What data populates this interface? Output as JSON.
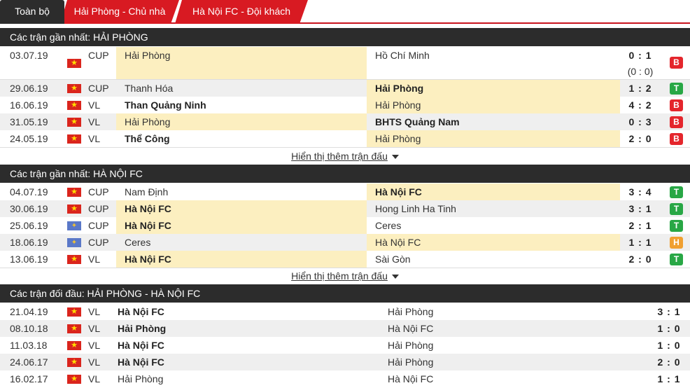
{
  "tabs": [
    "Toàn bộ",
    "Hải Phòng - Chủ nhà",
    "Hà Nội FC - Đội khách"
  ],
  "sections": [
    {
      "title": "Các trận gần nhất: HẢI PHÒNG",
      "more": "Hiển thị thêm trận đấu",
      "matches": [
        {
          "date": "03.07.19",
          "flag": "vn",
          "league": "CUP",
          "home": "Hải Phòng",
          "away": "Hồ Chí Minh",
          "score": "0 : 1",
          "score_sub": "(0 : 0)",
          "result": "B"
        },
        {
          "date": "29.06.19",
          "flag": "vn",
          "league": "CUP",
          "home": "Thanh Hóa",
          "away": "Hải Phòng",
          "score": "1 : 2",
          "result": "T"
        },
        {
          "date": "16.06.19",
          "flag": "vn",
          "league": "VL",
          "home": "Than Quảng Ninh",
          "away": "Hải Phòng",
          "score": "4 : 2",
          "result": "B"
        },
        {
          "date": "31.05.19",
          "flag": "vn",
          "league": "VL",
          "home": "Hải Phòng",
          "away": "BHTS Quảng Nam",
          "score": "0 : 3",
          "result": "B"
        },
        {
          "date": "24.05.19",
          "flag": "vn",
          "league": "VL",
          "home": "Thể Công",
          "away": "Hải Phòng",
          "score": "2 : 0",
          "result": "B"
        }
      ]
    },
    {
      "title": "Các trận gần nhất: HÀ NỘI FC",
      "more": "Hiển thị thêm trận đấu",
      "matches": [
        {
          "date": "04.07.19",
          "flag": "vn",
          "league": "CUP",
          "home": "Nam Định",
          "away": "Hà Nội FC",
          "score": "3 : 4",
          "result": "T"
        },
        {
          "date": "30.06.19",
          "flag": "vn",
          "league": "CUP",
          "home": "Hà Nội FC",
          "away": "Hong Linh Ha Tinh",
          "score": "3 : 1",
          "result": "T"
        },
        {
          "date": "25.06.19",
          "flag": "world",
          "league": "CUP",
          "home": "Hà Nội FC",
          "away": "Ceres",
          "score": "2 : 1",
          "result": "T"
        },
        {
          "date": "18.06.19",
          "flag": "world",
          "league": "CUP",
          "home": "Ceres",
          "away": "Hà Nội FC",
          "score": "1 : 1",
          "result": "H"
        },
        {
          "date": "13.06.19",
          "flag": "vn",
          "league": "VL",
          "home": "Hà Nội FC",
          "away": "Sài Gòn",
          "score": "2 : 0",
          "result": "T"
        }
      ]
    },
    {
      "title": "Các trận đối đầu: HẢI PHÒNG - HÀ NỘI FC",
      "matches": [
        {
          "date": "21.04.19",
          "flag": "vn",
          "league": "VL",
          "home": "Hà Nội FC",
          "away": "Hải Phòng",
          "score": "3 : 1"
        },
        {
          "date": "08.10.18",
          "flag": "vn",
          "league": "VL",
          "home": "Hải Phòng",
          "away": "Hà Nội FC",
          "score": "1 : 0"
        },
        {
          "date": "11.03.18",
          "flag": "vn",
          "league": "VL",
          "home": "Hà Nội FC",
          "away": "Hải Phòng",
          "score": "1 : 0"
        },
        {
          "date": "24.06.17",
          "flag": "vn",
          "league": "VL",
          "home": "Hà Nội FC",
          "away": "Hải Phòng",
          "score": "2 : 0"
        },
        {
          "date": "16.02.17",
          "flag": "vn",
          "league": "VL",
          "home": "Hải Phòng",
          "away": "Hà Nội FC",
          "score": "1 : 1"
        }
      ]
    }
  ],
  "colors": {
    "accent": "#d81a22",
    "header": "#2c2c2c",
    "highlight": "#fcefc0",
    "win": "#28a745",
    "loss": "#e4262c",
    "draw": "#f0a030"
  }
}
